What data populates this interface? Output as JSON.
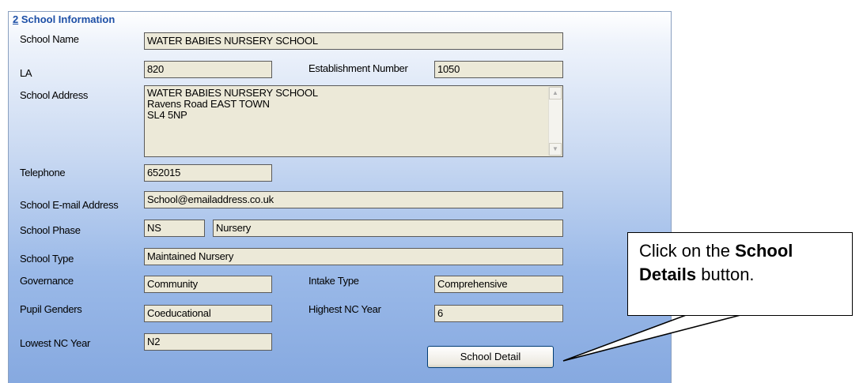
{
  "section": {
    "number": "2",
    "title": "School Information"
  },
  "labels": {
    "school_name": "School Name",
    "la": "LA",
    "establishment_number": "Establishment Number",
    "school_address": "School Address",
    "telephone": "Telephone",
    "email": "School E-mail Address",
    "phase": "School Phase",
    "type": "School Type",
    "governance": "Governance",
    "intake_type": "Intake Type",
    "pupil_genders": "Pupil Genders",
    "highest_nc_year": "Highest NC Year",
    "lowest_nc_year": "Lowest NC Year"
  },
  "values": {
    "school_name": "WATER BABIES NURSERY SCHOOL",
    "la": "820",
    "establishment_number": "1050",
    "address_lines": [
      "WATER BABIES NURSERY SCHOOL",
      "Ravens Road  EAST TOWN",
      "SL4 5NP"
    ],
    "telephone": "652015",
    "email": "School@emailaddress.co.uk",
    "phase_code": "NS",
    "phase_name": "Nursery",
    "type": "Maintained Nursery",
    "governance": "Community",
    "intake_type": "Comprehensive",
    "pupil_genders": "Coeducational",
    "highest_nc_year": "6",
    "lowest_nc_year": "N2"
  },
  "buttons": {
    "school_detail": "School Detail"
  },
  "icons": {
    "scroll_up": "scroll-up-arrow-icon",
    "scroll_down": "scroll-down-arrow-icon"
  },
  "callout": {
    "text_pre": "Click on the ",
    "bold": "School Details",
    "text_post": " button."
  },
  "colors": {
    "title": "#1d4fa6",
    "field_bg": "#ece9d8",
    "panel_bottom": "#86a9e0"
  }
}
